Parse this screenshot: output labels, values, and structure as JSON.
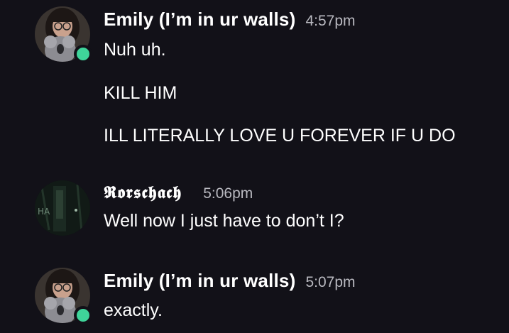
{
  "messages": [
    {
      "author": "Emily (I’m in ur walls)",
      "time": "4:57pm",
      "lines": [
        "Nuh uh.",
        "KILL HIM",
        "ILL LITERALLY LOVE U FOREVER IF U DO"
      ],
      "online": true
    },
    {
      "author": "𝕽𝖔𝖗𝖘𝖈𝖍𝖆𝖈𝖍",
      "time": "5:06pm",
      "lines": [
        "Well now I just have to don’t I?"
      ],
      "online": false
    },
    {
      "author": "Emily (I’m in ur walls)",
      "time": "5:07pm",
      "lines": [
        "exactly."
      ],
      "online": true
    }
  ],
  "colors": {
    "background": "#121118",
    "online_status": "#3fd49a",
    "timestamp": "#b9b9c0"
  },
  "icons": {
    "online": "online-status-icon"
  }
}
